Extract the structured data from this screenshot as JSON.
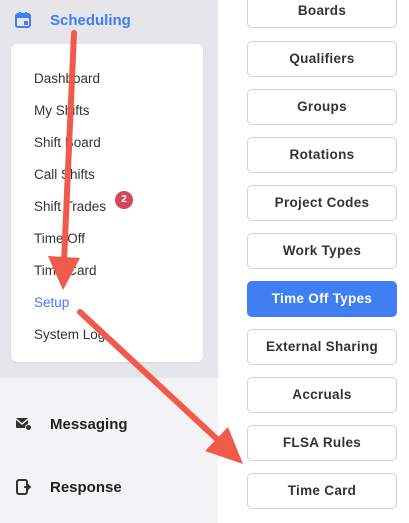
{
  "sidebar": {
    "scheduling": {
      "label": "Scheduling",
      "icon": "calendar-icon"
    },
    "submenu": [
      {
        "label": "Dashboard"
      },
      {
        "label": "My Shifts"
      },
      {
        "label": "Shift Board"
      },
      {
        "label": "Call Shifts"
      },
      {
        "label": "Shift Trades",
        "badge": "2"
      },
      {
        "label": "Time Off"
      },
      {
        "label": "Time Card"
      },
      {
        "label": "Setup",
        "active": true
      },
      {
        "label": "System Log"
      }
    ],
    "messaging": {
      "label": "Messaging",
      "icon": "message-icon"
    },
    "response": {
      "label": "Response",
      "icon": "response-icon"
    }
  },
  "setup_menu": [
    {
      "label": "Boards"
    },
    {
      "label": "Qualifiers"
    },
    {
      "label": "Groups"
    },
    {
      "label": "Rotations"
    },
    {
      "label": "Project Codes"
    },
    {
      "label": "Work Types"
    },
    {
      "label": "Time Off Types",
      "active": true
    },
    {
      "label": "External Sharing"
    },
    {
      "label": "Accruals"
    },
    {
      "label": "FLSA Rules"
    },
    {
      "label": "Time Card"
    }
  ],
  "colors": {
    "accent": "#3f7ef3",
    "badge": "#d2485a",
    "arrow": "#f05a4a"
  }
}
